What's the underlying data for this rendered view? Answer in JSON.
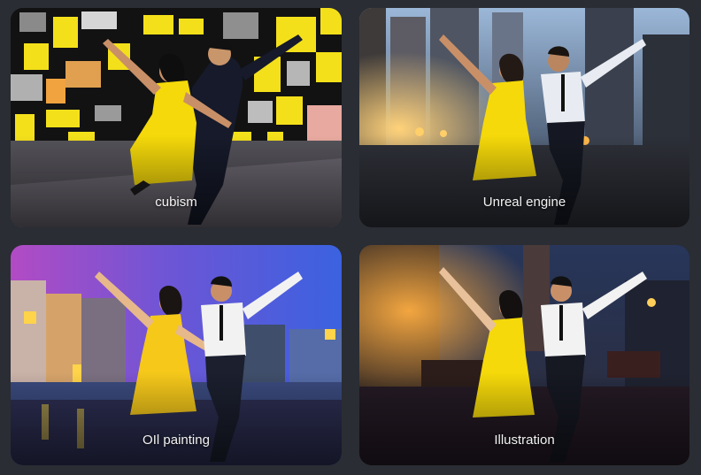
{
  "cards": [
    {
      "label": "cubism",
      "image": "dancing-couple-cubism"
    },
    {
      "label": "Unreal engine",
      "image": "dancing-couple-unreal-engine"
    },
    {
      "label": "OIl painting",
      "image": "dancing-couple-oil-painting"
    },
    {
      "label": "Illustration",
      "image": "dancing-couple-illustration"
    }
  ],
  "colors": {
    "background": "#2a2d33",
    "dress": "#f5d90a",
    "text": "#f2f2f2"
  }
}
